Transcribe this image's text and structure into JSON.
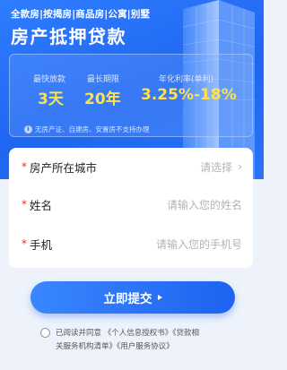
{
  "hero": {
    "tagline": "全款房|按揭房|商品房|公寓|别墅",
    "title": "房产抵押贷款"
  },
  "stats": [
    {
      "label": "最快放款",
      "value": "3天"
    },
    {
      "label": "最长期限",
      "value": "20年"
    },
    {
      "label": "年化利率(单利)",
      "value": "3.25%-18%"
    }
  ],
  "notice": "无房产证、自建房、安置房不支持办理",
  "form": {
    "city": {
      "label": "房产所在城市",
      "value": "请选择"
    },
    "name": {
      "label": "姓名",
      "placeholder": "请输入您的姓名"
    },
    "phone": {
      "label": "手机",
      "placeholder": "请输入您的手机号"
    }
  },
  "submit_label": "立即提交",
  "agreement": {
    "line1": "已阅读并同意 《个人信息授权书》《贷款相",
    "line2": "关服务机构清单》《用户服务协议》"
  },
  "colors": {
    "accent": "#1f66f0",
    "highlight": "#ffe14a",
    "required": "#e8332f"
  }
}
